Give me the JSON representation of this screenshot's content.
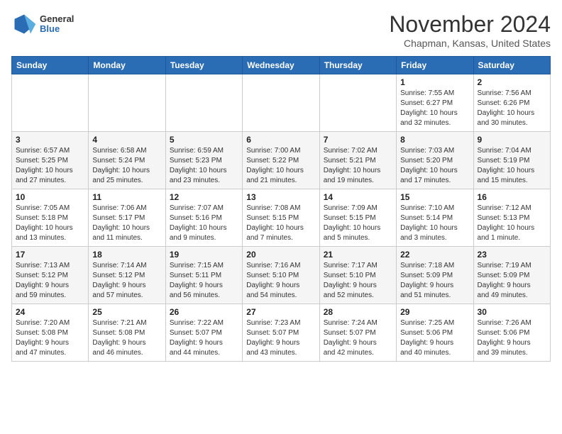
{
  "header": {
    "logo_general": "General",
    "logo_blue": "Blue",
    "month_title": "November 2024",
    "location": "Chapman, Kansas, United States"
  },
  "weekdays": [
    "Sunday",
    "Monday",
    "Tuesday",
    "Wednesday",
    "Thursday",
    "Friday",
    "Saturday"
  ],
  "weeks": [
    [
      {
        "day": "",
        "info": ""
      },
      {
        "day": "",
        "info": ""
      },
      {
        "day": "",
        "info": ""
      },
      {
        "day": "",
        "info": ""
      },
      {
        "day": "",
        "info": ""
      },
      {
        "day": "1",
        "info": "Sunrise: 7:55 AM\nSunset: 6:27 PM\nDaylight: 10 hours\nand 32 minutes."
      },
      {
        "day": "2",
        "info": "Sunrise: 7:56 AM\nSunset: 6:26 PM\nDaylight: 10 hours\nand 30 minutes."
      }
    ],
    [
      {
        "day": "3",
        "info": "Sunrise: 6:57 AM\nSunset: 5:25 PM\nDaylight: 10 hours\nand 27 minutes."
      },
      {
        "day": "4",
        "info": "Sunrise: 6:58 AM\nSunset: 5:24 PM\nDaylight: 10 hours\nand 25 minutes."
      },
      {
        "day": "5",
        "info": "Sunrise: 6:59 AM\nSunset: 5:23 PM\nDaylight: 10 hours\nand 23 minutes."
      },
      {
        "day": "6",
        "info": "Sunrise: 7:00 AM\nSunset: 5:22 PM\nDaylight: 10 hours\nand 21 minutes."
      },
      {
        "day": "7",
        "info": "Sunrise: 7:02 AM\nSunset: 5:21 PM\nDaylight: 10 hours\nand 19 minutes."
      },
      {
        "day": "8",
        "info": "Sunrise: 7:03 AM\nSunset: 5:20 PM\nDaylight: 10 hours\nand 17 minutes."
      },
      {
        "day": "9",
        "info": "Sunrise: 7:04 AM\nSunset: 5:19 PM\nDaylight: 10 hours\nand 15 minutes."
      }
    ],
    [
      {
        "day": "10",
        "info": "Sunrise: 7:05 AM\nSunset: 5:18 PM\nDaylight: 10 hours\nand 13 minutes."
      },
      {
        "day": "11",
        "info": "Sunrise: 7:06 AM\nSunset: 5:17 PM\nDaylight: 10 hours\nand 11 minutes."
      },
      {
        "day": "12",
        "info": "Sunrise: 7:07 AM\nSunset: 5:16 PM\nDaylight: 10 hours\nand 9 minutes."
      },
      {
        "day": "13",
        "info": "Sunrise: 7:08 AM\nSunset: 5:15 PM\nDaylight: 10 hours\nand 7 minutes."
      },
      {
        "day": "14",
        "info": "Sunrise: 7:09 AM\nSunset: 5:15 PM\nDaylight: 10 hours\nand 5 minutes."
      },
      {
        "day": "15",
        "info": "Sunrise: 7:10 AM\nSunset: 5:14 PM\nDaylight: 10 hours\nand 3 minutes."
      },
      {
        "day": "16",
        "info": "Sunrise: 7:12 AM\nSunset: 5:13 PM\nDaylight: 10 hours\nand 1 minute."
      }
    ],
    [
      {
        "day": "17",
        "info": "Sunrise: 7:13 AM\nSunset: 5:12 PM\nDaylight: 9 hours\nand 59 minutes."
      },
      {
        "day": "18",
        "info": "Sunrise: 7:14 AM\nSunset: 5:12 PM\nDaylight: 9 hours\nand 57 minutes."
      },
      {
        "day": "19",
        "info": "Sunrise: 7:15 AM\nSunset: 5:11 PM\nDaylight: 9 hours\nand 56 minutes."
      },
      {
        "day": "20",
        "info": "Sunrise: 7:16 AM\nSunset: 5:10 PM\nDaylight: 9 hours\nand 54 minutes."
      },
      {
        "day": "21",
        "info": "Sunrise: 7:17 AM\nSunset: 5:10 PM\nDaylight: 9 hours\nand 52 minutes."
      },
      {
        "day": "22",
        "info": "Sunrise: 7:18 AM\nSunset: 5:09 PM\nDaylight: 9 hours\nand 51 minutes."
      },
      {
        "day": "23",
        "info": "Sunrise: 7:19 AM\nSunset: 5:09 PM\nDaylight: 9 hours\nand 49 minutes."
      }
    ],
    [
      {
        "day": "24",
        "info": "Sunrise: 7:20 AM\nSunset: 5:08 PM\nDaylight: 9 hours\nand 47 minutes."
      },
      {
        "day": "25",
        "info": "Sunrise: 7:21 AM\nSunset: 5:08 PM\nDaylight: 9 hours\nand 46 minutes."
      },
      {
        "day": "26",
        "info": "Sunrise: 7:22 AM\nSunset: 5:07 PM\nDaylight: 9 hours\nand 44 minutes."
      },
      {
        "day": "27",
        "info": "Sunrise: 7:23 AM\nSunset: 5:07 PM\nDaylight: 9 hours\nand 43 minutes."
      },
      {
        "day": "28",
        "info": "Sunrise: 7:24 AM\nSunset: 5:07 PM\nDaylight: 9 hours\nand 42 minutes."
      },
      {
        "day": "29",
        "info": "Sunrise: 7:25 AM\nSunset: 5:06 PM\nDaylight: 9 hours\nand 40 minutes."
      },
      {
        "day": "30",
        "info": "Sunrise: 7:26 AM\nSunset: 5:06 PM\nDaylight: 9 hours\nand 39 minutes."
      }
    ]
  ]
}
